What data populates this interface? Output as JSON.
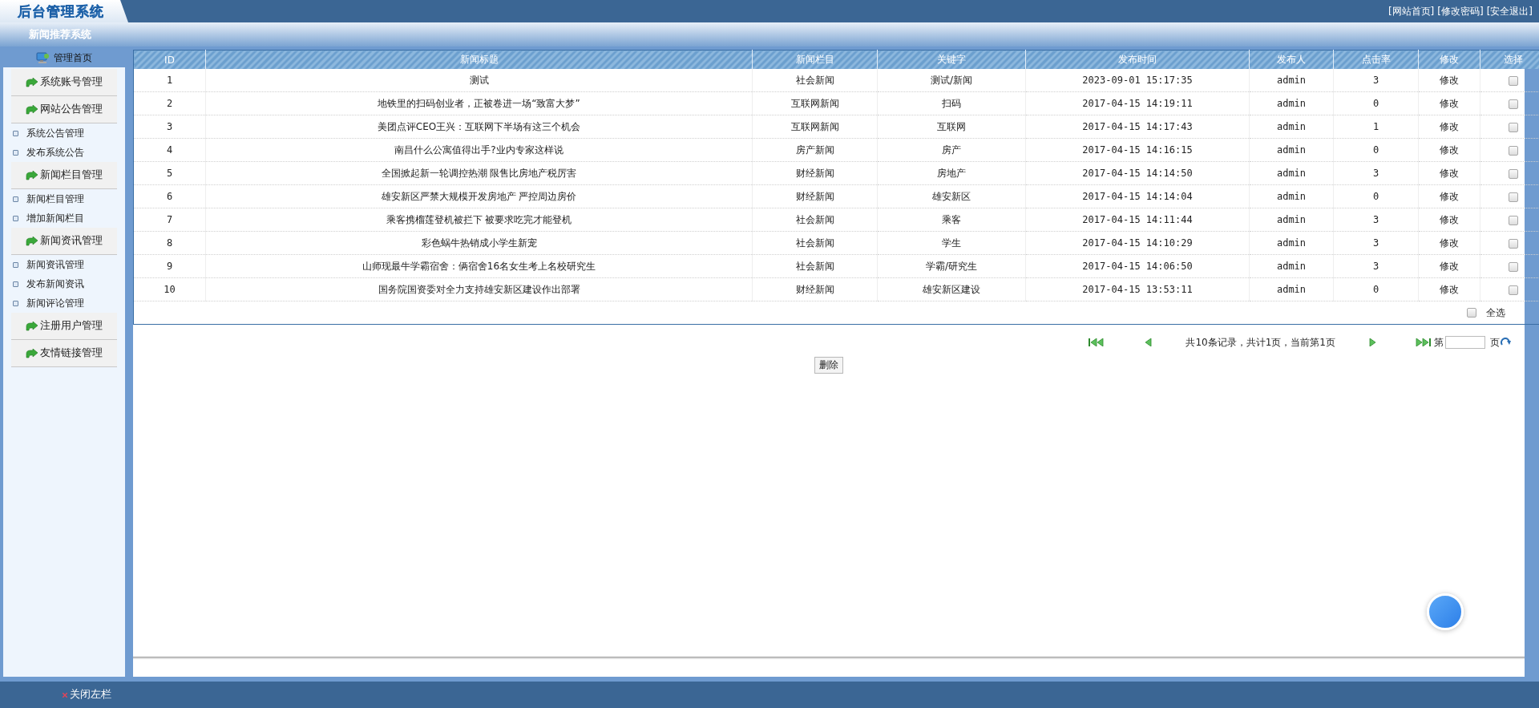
{
  "header": {
    "title": "后台管理系统",
    "subtitle": "新闻推荐系统",
    "links": [
      "[网站首页]",
      "[修改密码]",
      "[安全退出]"
    ]
  },
  "sidebar": {
    "home": "管理首页",
    "items": [
      {
        "kind": "group",
        "label": "系统账号管理"
      },
      {
        "kind": "group",
        "label": "网站公告管理"
      },
      {
        "kind": "link",
        "label": "系统公告管理"
      },
      {
        "kind": "link",
        "label": "发布系统公告"
      },
      {
        "kind": "group",
        "label": "新闻栏目管理"
      },
      {
        "kind": "link",
        "label": "新闻栏目管理"
      },
      {
        "kind": "link",
        "label": "增加新闻栏目"
      },
      {
        "kind": "group",
        "label": "新闻资讯管理"
      },
      {
        "kind": "link",
        "label": "新闻资讯管理"
      },
      {
        "kind": "link",
        "label": "发布新闻资讯"
      },
      {
        "kind": "link",
        "label": "新闻评论管理"
      },
      {
        "kind": "group",
        "label": "注册用户管理"
      },
      {
        "kind": "group",
        "label": "友情链接管理"
      }
    ]
  },
  "table": {
    "columns": [
      "ID",
      "新闻标题",
      "新闻栏目",
      "关键字",
      "发布时间",
      "发布人",
      "点击率",
      "修改",
      "选择"
    ],
    "rows": [
      {
        "id": "1",
        "title": "测试",
        "category": "社会新闻",
        "keywords": "测试/新闻",
        "time": "2023-09-01 15:17:35",
        "author": "admin",
        "clicks": "3",
        "edit": "修改",
        "selected": false
      },
      {
        "id": "2",
        "title": "地铁里的扫码创业者，正被卷进一场“致富大梦”",
        "category": "互联网新闻",
        "keywords": "扫码",
        "time": "2017-04-15 14:19:11",
        "author": "admin",
        "clicks": "0",
        "edit": "修改",
        "selected": false
      },
      {
        "id": "3",
        "title": "美团点评CEO王兴：互联网下半场有这三个机会",
        "category": "互联网新闻",
        "keywords": "互联网",
        "time": "2017-04-15 14:17:43",
        "author": "admin",
        "clicks": "1",
        "edit": "修改",
        "selected": false
      },
      {
        "id": "4",
        "title": "南昌什么公寓值得出手?业内专家这样说",
        "category": "房产新闻",
        "keywords": "房产",
        "time": "2017-04-15 14:16:15",
        "author": "admin",
        "clicks": "0",
        "edit": "修改",
        "selected": false
      },
      {
        "id": "5",
        "title": "全国掀起新一轮调控热潮 限售比房地产税厉害",
        "category": "财经新闻",
        "keywords": "房地产",
        "time": "2017-04-15 14:14:50",
        "author": "admin",
        "clicks": "3",
        "edit": "修改",
        "selected": false
      },
      {
        "id": "6",
        "title": "雄安新区严禁大规模开发房地产 严控周边房价",
        "category": "财经新闻",
        "keywords": "雄安新区",
        "time": "2017-04-15 14:14:04",
        "author": "admin",
        "clicks": "0",
        "edit": "修改",
        "selected": false
      },
      {
        "id": "7",
        "title": "乘客携榴莲登机被拦下 被要求吃完才能登机",
        "category": "社会新闻",
        "keywords": "乘客",
        "time": "2017-04-15 14:11:44",
        "author": "admin",
        "clicks": "3",
        "edit": "修改",
        "selected": false
      },
      {
        "id": "8",
        "title": "彩色蜗牛热销成小学生新宠",
        "category": "社会新闻",
        "keywords": "学生",
        "time": "2017-04-15 14:10:29",
        "author": "admin",
        "clicks": "3",
        "edit": "修改",
        "selected": false
      },
      {
        "id": "9",
        "title": "山师现最牛学霸宿舍：俩宿舍16名女生考上名校研究生",
        "category": "社会新闻",
        "keywords": "学霸/研究生",
        "time": "2017-04-15 14:06:50",
        "author": "admin",
        "clicks": "3",
        "edit": "修改",
        "selected": false
      },
      {
        "id": "10",
        "title": "国务院国资委对全力支持雄安新区建设作出部署",
        "category": "财经新闻",
        "keywords": "雄安新区建设",
        "time": "2017-04-15 13:53:11",
        "author": "admin",
        "clicks": "0",
        "edit": "修改",
        "selected": false
      }
    ],
    "select_all": {
      "label": "全选",
      "checked": false
    }
  },
  "pagination": {
    "summary": "共10条记录，共计1页，当前第1页",
    "page_prefix": "第",
    "page_suffix": "页"
  },
  "delete_button": "删除",
  "footer": {
    "close_sidebar": "关闭左栏"
  }
}
